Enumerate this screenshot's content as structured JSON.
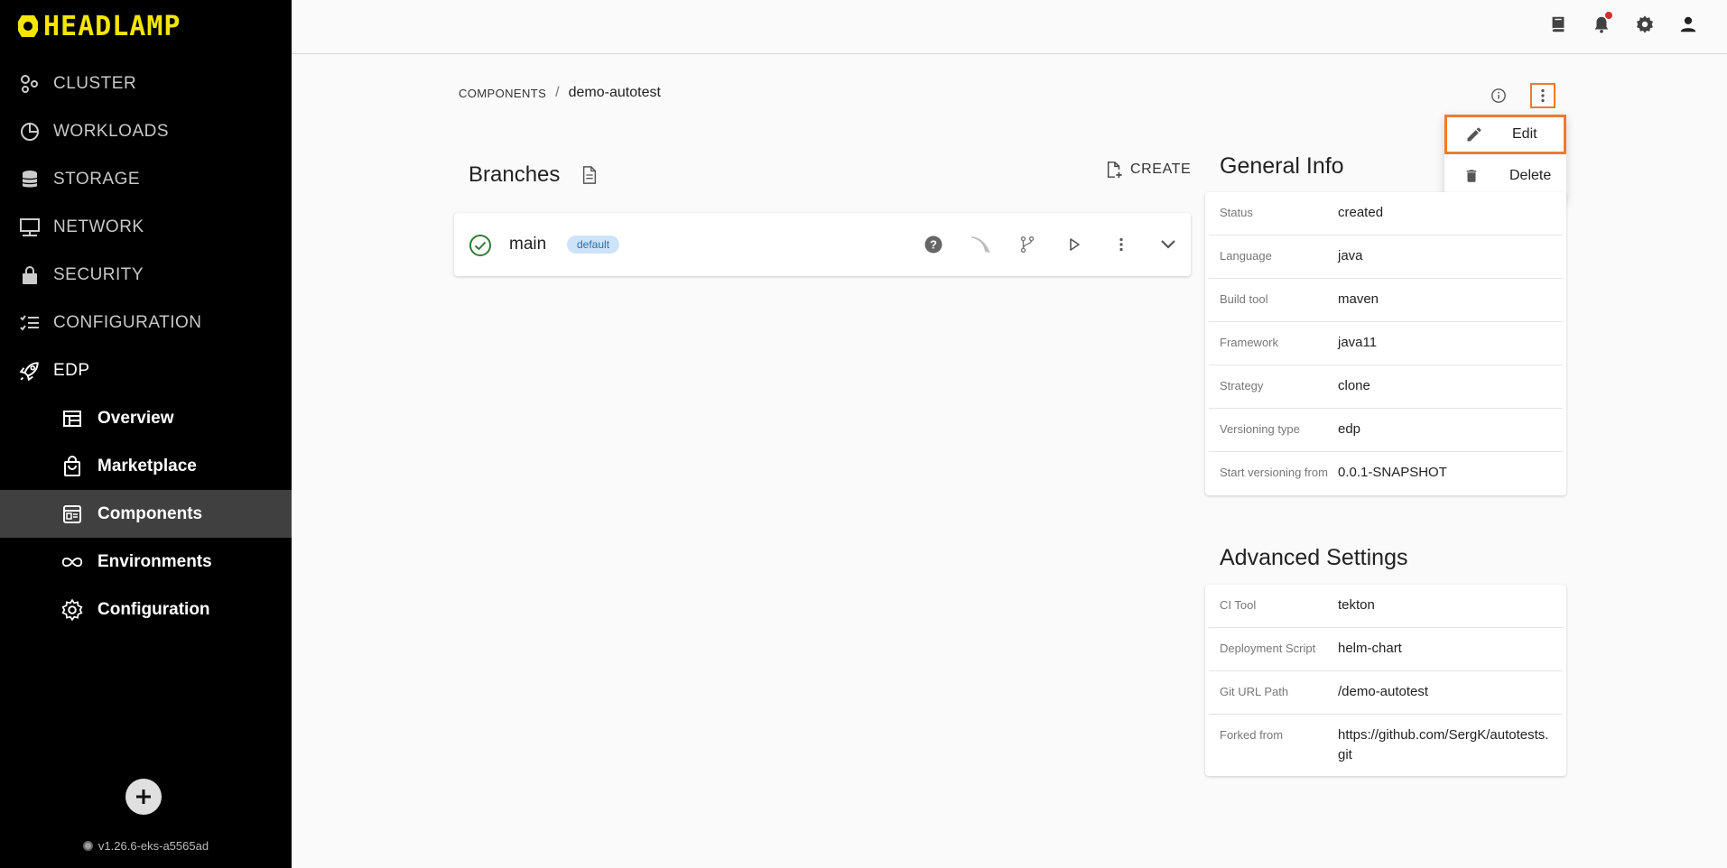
{
  "app": {
    "logo_text": "HEADLAMP",
    "version": "v1.26.6-eks-a5565ad"
  },
  "sidebar": {
    "items": [
      {
        "label": "CLUSTER",
        "icon": "cluster-icon"
      },
      {
        "label": "WORKLOADS",
        "icon": "workloads-icon"
      },
      {
        "label": "STORAGE",
        "icon": "storage-icon"
      },
      {
        "label": "NETWORK",
        "icon": "network-icon"
      },
      {
        "label": "SECURITY",
        "icon": "lock-icon"
      },
      {
        "label": "CONFIGURATION",
        "icon": "configuration-icon"
      },
      {
        "label": "EDP",
        "icon": "rocket-icon"
      }
    ],
    "sub_items": [
      {
        "label": "Overview",
        "icon": "overview-icon"
      },
      {
        "label": "Marketplace",
        "icon": "shopping-bag-icon"
      },
      {
        "label": "Components",
        "icon": "components-icon",
        "active": true
      },
      {
        "label": "Environments",
        "icon": "infinity-icon"
      },
      {
        "label": "Configuration",
        "icon": "gear-icon"
      }
    ]
  },
  "breadcrumb": {
    "parent": "COMPONENTS",
    "separator": "/",
    "current": "demo-autotest"
  },
  "menu": {
    "edit": "Edit",
    "delete": "Delete"
  },
  "branches": {
    "title": "Branches",
    "create_label": "CREATE",
    "items": [
      {
        "name": "main",
        "badge": "default"
      }
    ]
  },
  "general_info": {
    "title": "General Info",
    "rows": [
      {
        "key": "Status",
        "value": "created"
      },
      {
        "key": "Language",
        "value": "java"
      },
      {
        "key": "Build tool",
        "value": "maven"
      },
      {
        "key": "Framework",
        "value": "java11"
      },
      {
        "key": "Strategy",
        "value": "clone"
      },
      {
        "key": "Versioning type",
        "value": "edp"
      },
      {
        "key": "Start versioning from",
        "value": "0.0.1-SNAPSHOT"
      }
    ]
  },
  "advanced_settings": {
    "title": "Advanced Settings",
    "rows": [
      {
        "key": "CI Tool",
        "value": "tekton"
      },
      {
        "key": "Deployment Script",
        "value": "helm-chart"
      },
      {
        "key": "Git URL Path",
        "value": "/demo-autotest"
      },
      {
        "key": "Forked from",
        "value": "https://github.com/SergK/autotests.git"
      }
    ]
  },
  "colors": {
    "accent": "#f07a2c",
    "logo": "#f4e600",
    "badge_bg": "#cfe3f8",
    "success": "#2e7d32"
  }
}
